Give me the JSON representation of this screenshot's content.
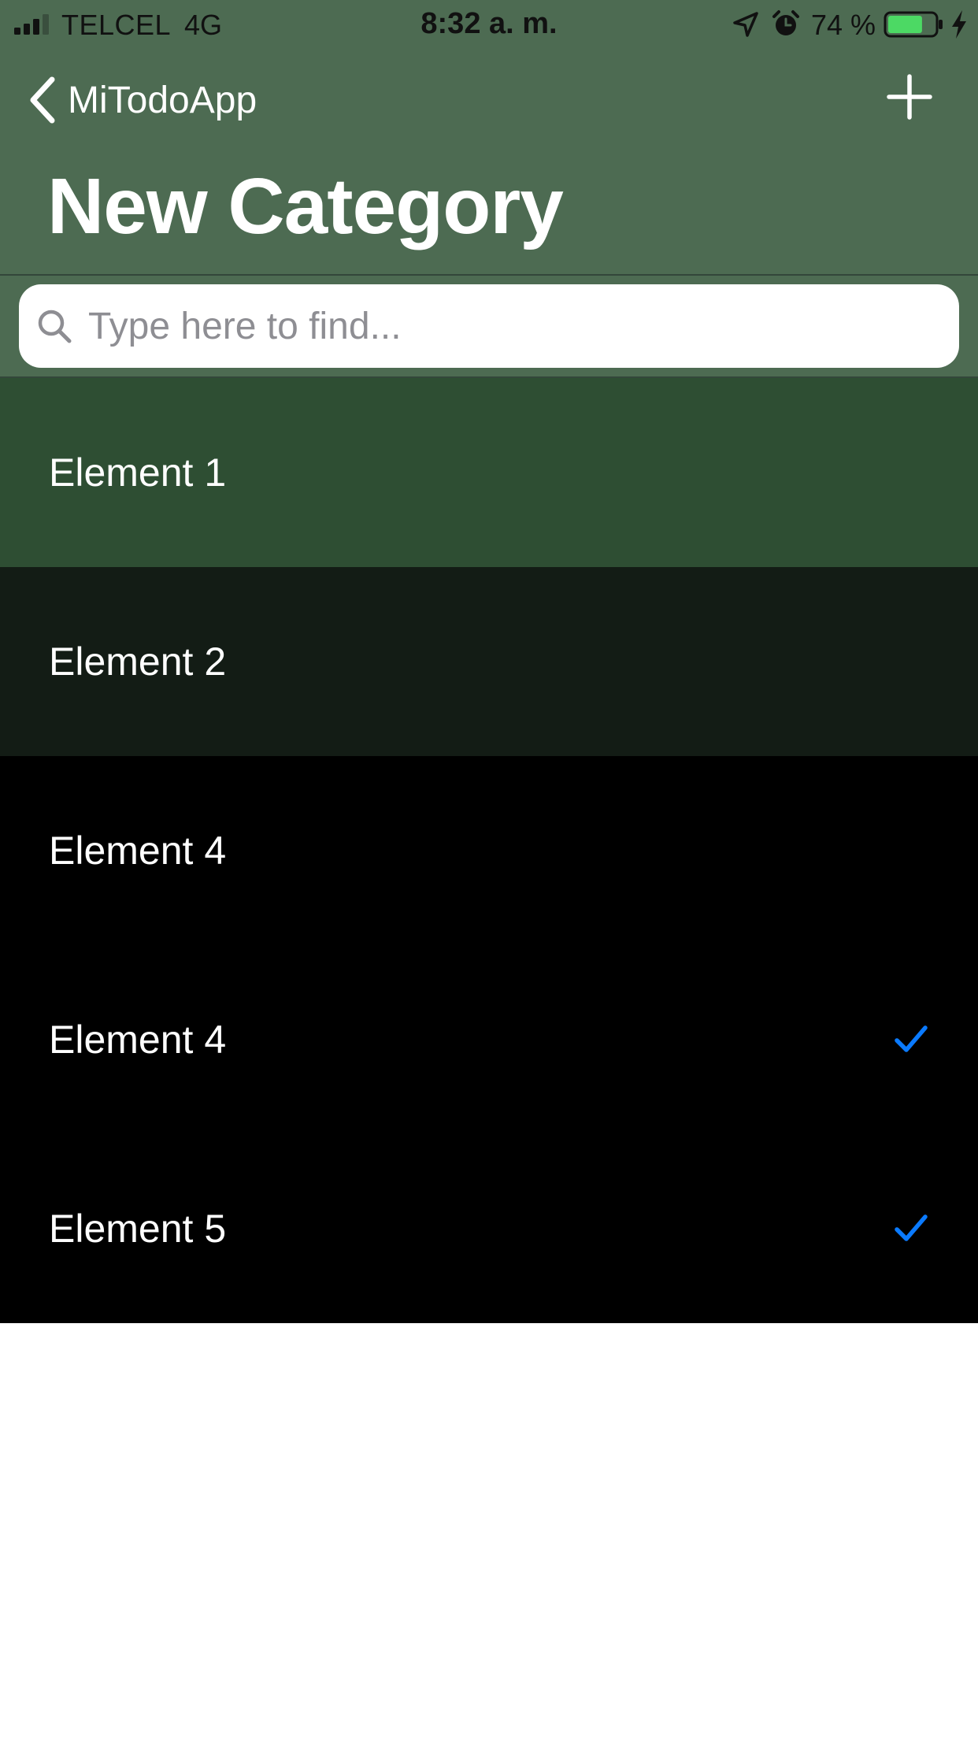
{
  "status_bar": {
    "carrier": "TELCEL",
    "network": "4G",
    "time": "8:32 a. m.",
    "battery_percent": "74 %",
    "battery_level": 0.74,
    "icons": [
      "signal-icon",
      "location-arrow-icon",
      "alarm-icon",
      "battery-icon",
      "charging-bolt-icon"
    ]
  },
  "nav": {
    "back_label": "MiTodoApp",
    "back_icon": "chevron-left-icon",
    "add_icon": "plus-icon",
    "title": "New Category"
  },
  "search": {
    "placeholder": "Type here to find...",
    "value": "",
    "icon": "magnifying-glass-icon"
  },
  "items": [
    {
      "label": "Element 1",
      "checked": false,
      "background": "#2e4e33"
    },
    {
      "label": "Element 2",
      "checked": false,
      "background": "#131c15"
    },
    {
      "label": "Element 4",
      "checked": false,
      "background": "#000000"
    },
    {
      "label": "Element 4",
      "checked": true,
      "background": "#000000"
    },
    {
      "label": "Element 5",
      "checked": true,
      "background": "#000000"
    }
  ],
  "colors": {
    "header": "#4d6b52",
    "checkmark": "#0a7aff",
    "battery_fill": "#4cd964"
  }
}
